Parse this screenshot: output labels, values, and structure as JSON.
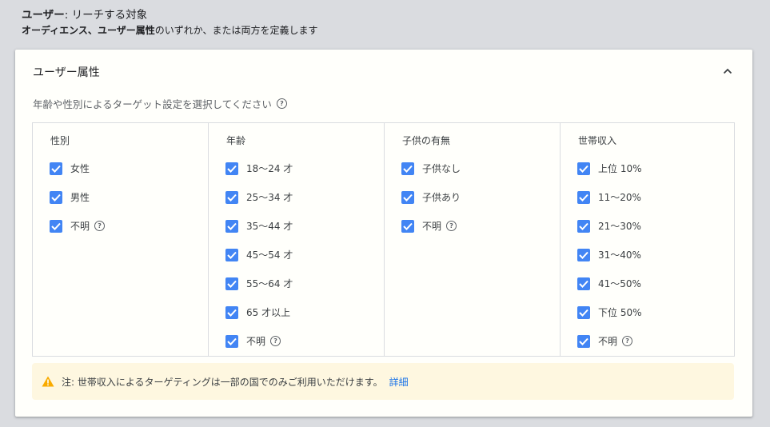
{
  "header": {
    "title_bold": "ユーザー",
    "title_rest": ": リーチする対象",
    "subtitle_bold1": "オーディエンス",
    "subtitle_sep": "、",
    "subtitle_bold2": "ユーザー属性",
    "subtitle_rest": "のいずれか、または両方を定義します"
  },
  "card": {
    "title": "ユーザー属性",
    "collapse_icon": "chevron-up-icon",
    "instruction": "年齢や性別によるターゲット設定を選択してください"
  },
  "columns": [
    {
      "header": "性別",
      "options": [
        {
          "label": "女性",
          "checked": true,
          "help": false
        },
        {
          "label": "男性",
          "checked": true,
          "help": false
        },
        {
          "label": "不明",
          "checked": true,
          "help": true
        }
      ]
    },
    {
      "header": "年齢",
      "options": [
        {
          "label": "18～24 才",
          "checked": true,
          "help": false
        },
        {
          "label": "25～34 才",
          "checked": true,
          "help": false
        },
        {
          "label": "35～44 才",
          "checked": true,
          "help": false
        },
        {
          "label": "45～54 才",
          "checked": true,
          "help": false
        },
        {
          "label": "55～64 才",
          "checked": true,
          "help": false
        },
        {
          "label": "65 才以上",
          "checked": true,
          "help": false
        },
        {
          "label": "不明",
          "checked": true,
          "help": true
        }
      ]
    },
    {
      "header": "子供の有無",
      "options": [
        {
          "label": "子供なし",
          "checked": true,
          "help": false
        },
        {
          "label": "子供あり",
          "checked": true,
          "help": false
        },
        {
          "label": "不明",
          "checked": true,
          "help": true
        }
      ]
    },
    {
      "header": "世帯収入",
      "options": [
        {
          "label": "上位 10%",
          "checked": true,
          "help": false
        },
        {
          "label": "11～20%",
          "checked": true,
          "help": false
        },
        {
          "label": "21～30%",
          "checked": true,
          "help": false
        },
        {
          "label": "31～40%",
          "checked": true,
          "help": false
        },
        {
          "label": "41～50%",
          "checked": true,
          "help": false
        },
        {
          "label": "下位 50%",
          "checked": true,
          "help": false
        },
        {
          "label": "不明",
          "checked": true,
          "help": true
        }
      ]
    }
  ],
  "notice": {
    "text": "注: 世帯収入によるターゲティングは一部の国でのみご利用いただけます。",
    "link": "詳細",
    "icon": "warning-icon"
  },
  "colors": {
    "checkbox": "#4285f4",
    "link": "#1a73e8",
    "warning": "#f9ab00",
    "notice_bg": "#fef7e0"
  }
}
